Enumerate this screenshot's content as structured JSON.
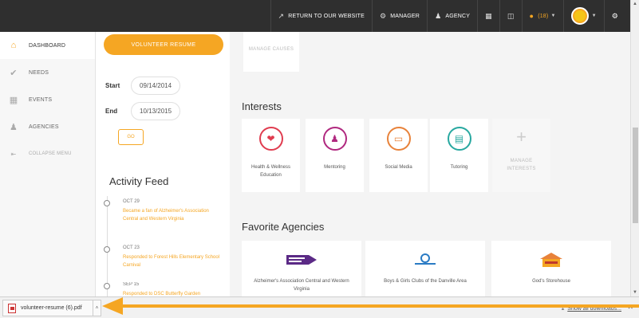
{
  "topbar": {
    "return_label": "RETURN TO OUR WEBSITE",
    "manager_label": "MANAGER",
    "agency_label": "AGENCY",
    "notifications_label": "(18)"
  },
  "sidebar": {
    "items": [
      {
        "label": "DASHBOARD",
        "icon": "home-icon"
      },
      {
        "label": "NEEDS",
        "icon": "check-circle-icon"
      },
      {
        "label": "EVENTS",
        "icon": "calendar-icon"
      },
      {
        "label": "AGENCIES",
        "icon": "users-icon"
      },
      {
        "label": "COLLAPSE MENU",
        "icon": "collapse-icon"
      }
    ]
  },
  "middle": {
    "volunteer_resume_label": "VOLUNTEER RESUME",
    "start_label": "Start",
    "start_value": "09/14/2014",
    "end_label": "End",
    "end_value": "10/13/2015",
    "go_label": "GO",
    "activity_title": "Activity Feed",
    "feed": [
      {
        "date": "OCT 29",
        "text": "Became a fan of Alzheimer's Association Central and Western Virginia"
      },
      {
        "date": "OCT 23",
        "text": "Responded to Forest Hills Elementary School Carnival"
      },
      {
        "date": "SEP 15",
        "text": "Responded to DSC Butterfly Garden"
      }
    ]
  },
  "main": {
    "manage_causes_label": "MANAGE CAUSES",
    "interests_title": "Interests",
    "interests": [
      {
        "label": "Health & Wellness Education",
        "icon": "heart-icon",
        "color": "#e03c4f"
      },
      {
        "label": "Mentoring",
        "icon": "people-icon",
        "color": "#b0287f"
      },
      {
        "label": "Social Media",
        "icon": "laptop-icon",
        "color": "#e8823a"
      },
      {
        "label": "Tutoring",
        "icon": "books-icon",
        "color": "#27a8a0"
      }
    ],
    "manage_interests_label": "MANAGE INTERESTS",
    "agencies_title": "Favorite Agencies",
    "agencies": [
      {
        "name": "Alzheimer's Association Central and Western Virginia",
        "logo": "WALK TO END ALZHEIMER'S"
      },
      {
        "name": "Boys & Girls Clubs of the Danville Area",
        "logo": "bgc-logo"
      },
      {
        "name": "God's Storehouse",
        "logo": "gods-storehouse-logo"
      }
    ]
  },
  "download_bar": {
    "file_name": "volunteer-resume (6).pdf",
    "show_all_label": "Show all downloads..."
  },
  "colors": {
    "accent": "#f5a623",
    "topbar": "#2f2f2f"
  }
}
